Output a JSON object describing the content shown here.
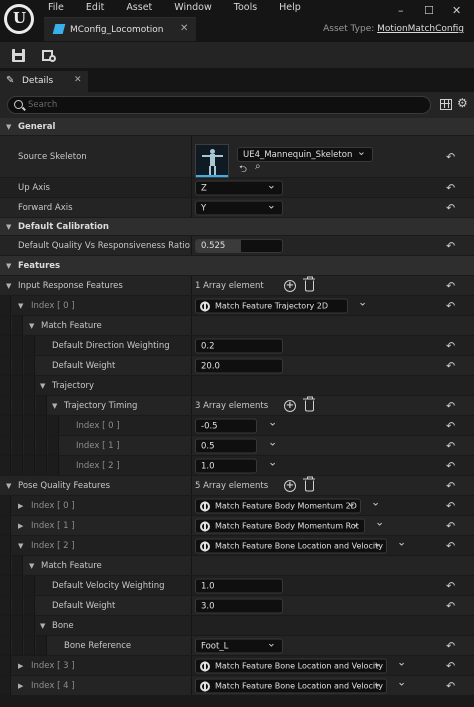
{
  "window": {
    "logo_letter": "U",
    "menu": [
      "File",
      "Edit",
      "Asset",
      "Window",
      "Tools",
      "Help"
    ],
    "controls": [
      "–",
      "☐",
      "✕"
    ],
    "tab_title": "MConfig_Locomotion",
    "tab_close": "✕",
    "asset_type_label": "Asset Type:",
    "asset_type_value": "MotionMatchConfig"
  },
  "toolbar": {
    "icons": [
      "save-icon",
      "browse-icon"
    ]
  },
  "details_tab": {
    "label": "Details",
    "close": "✕",
    "pen": "✎"
  },
  "search": {
    "placeholder": "Search",
    "grid_icon": "table-view-icon",
    "gear_icon": "⚙"
  },
  "general": {
    "title": "General",
    "source_skeleton_label": "Source Skeleton",
    "source_skeleton_value": "UE4_Mannequin_Skeleton",
    "up_axis_label": "Up Axis",
    "up_axis_value": "Z",
    "forward_axis_label": "Forward Axis",
    "forward_axis_value": "Y"
  },
  "calibration": {
    "title": "Default Calibration",
    "quality_label": "Default Quality Vs Responsiveness Ratio",
    "quality_value": "0.525",
    "quality_fraction": 0.525
  },
  "features": {
    "title": "Features",
    "input_label": "Input Response Features",
    "input_count": "1 Array element",
    "input_index0_label": "Index [ 0 ]",
    "input_index0_value": "Match Feature Trajectory 2D",
    "match_feature_label": "Match Feature",
    "dir_weight_label": "Default Direction Weighting",
    "dir_weight_value": "0.2",
    "weight_label": "Default Weight",
    "weight_value": "20.0",
    "trajectory_label": "Trajectory",
    "timing_label": "Trajectory Timing",
    "timing_count": "3 Array elements",
    "timing": [
      {
        "label": "Index [ 0 ]",
        "value": "-0.5"
      },
      {
        "label": "Index [ 1 ]",
        "value": "0.5"
      },
      {
        "label": "Index [ 2 ]",
        "value": "1.0"
      }
    ],
    "pose_label": "Pose Quality Features",
    "pose_count": "5 Array elements",
    "pose": [
      {
        "label": "Index [ 0 ]",
        "value": "Match Feature Body Momentum 2D"
      },
      {
        "label": "Index [ 1 ]",
        "value": "Match Feature Body Momentum Rot"
      },
      {
        "label": "Index [ 2 ]",
        "value": "Match Feature Bone Location and Velocity"
      },
      {
        "label": "Index [ 3 ]",
        "value": "Match Feature Bone Location and Velocity"
      },
      {
        "label": "Index [ 4 ]",
        "value": "Match Feature Bone Location and Velocity"
      }
    ],
    "pose_match_feature_label": "Match Feature",
    "vel_weight_label": "Default Velocity Weighting",
    "vel_weight_value": "1.0",
    "pose_weight_label": "Default Weight",
    "pose_weight_value": "3.0",
    "bone_label": "Bone",
    "bone_ref_label": "Bone Reference",
    "bone_ref_value": "Foot_L"
  }
}
